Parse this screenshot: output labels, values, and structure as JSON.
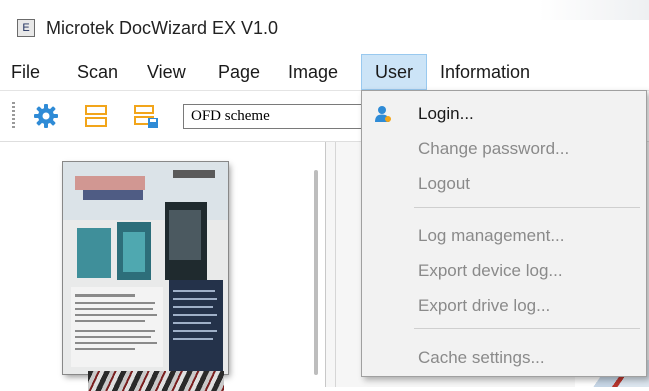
{
  "window": {
    "icon_letter": "E",
    "title": "Microtek DocWizard EX V1.0"
  },
  "menubar": {
    "items": [
      {
        "label": "File"
      },
      {
        "label": "Scan"
      },
      {
        "label": "View"
      },
      {
        "label": "Page"
      },
      {
        "label": "Image"
      },
      {
        "label": "User"
      },
      {
        "label": "Information"
      }
    ],
    "active": "User"
  },
  "toolbar": {
    "icons": [
      "gear-icon",
      "split-pages-icon",
      "split-save-icon"
    ],
    "scheme_select": {
      "value": "OFD scheme"
    }
  },
  "user_menu": {
    "items": [
      {
        "label": "Login...",
        "enabled": true,
        "icon": "user-icon"
      },
      {
        "label": "Change password...",
        "enabled": false
      },
      {
        "label": "Logout",
        "enabled": false
      },
      {
        "label": "Log management...",
        "enabled": false
      },
      {
        "label": "Export device log...",
        "enabled": false
      },
      {
        "label": "Export drive log...",
        "enabled": false
      },
      {
        "label": "Cache settings...",
        "enabled": false
      }
    ]
  },
  "colors": {
    "accent_blue": "#2f8bd6",
    "icon_orange": "#f2a51a",
    "menu_highlight": "#cce4f7",
    "disabled_text": "#8a8a8a"
  }
}
